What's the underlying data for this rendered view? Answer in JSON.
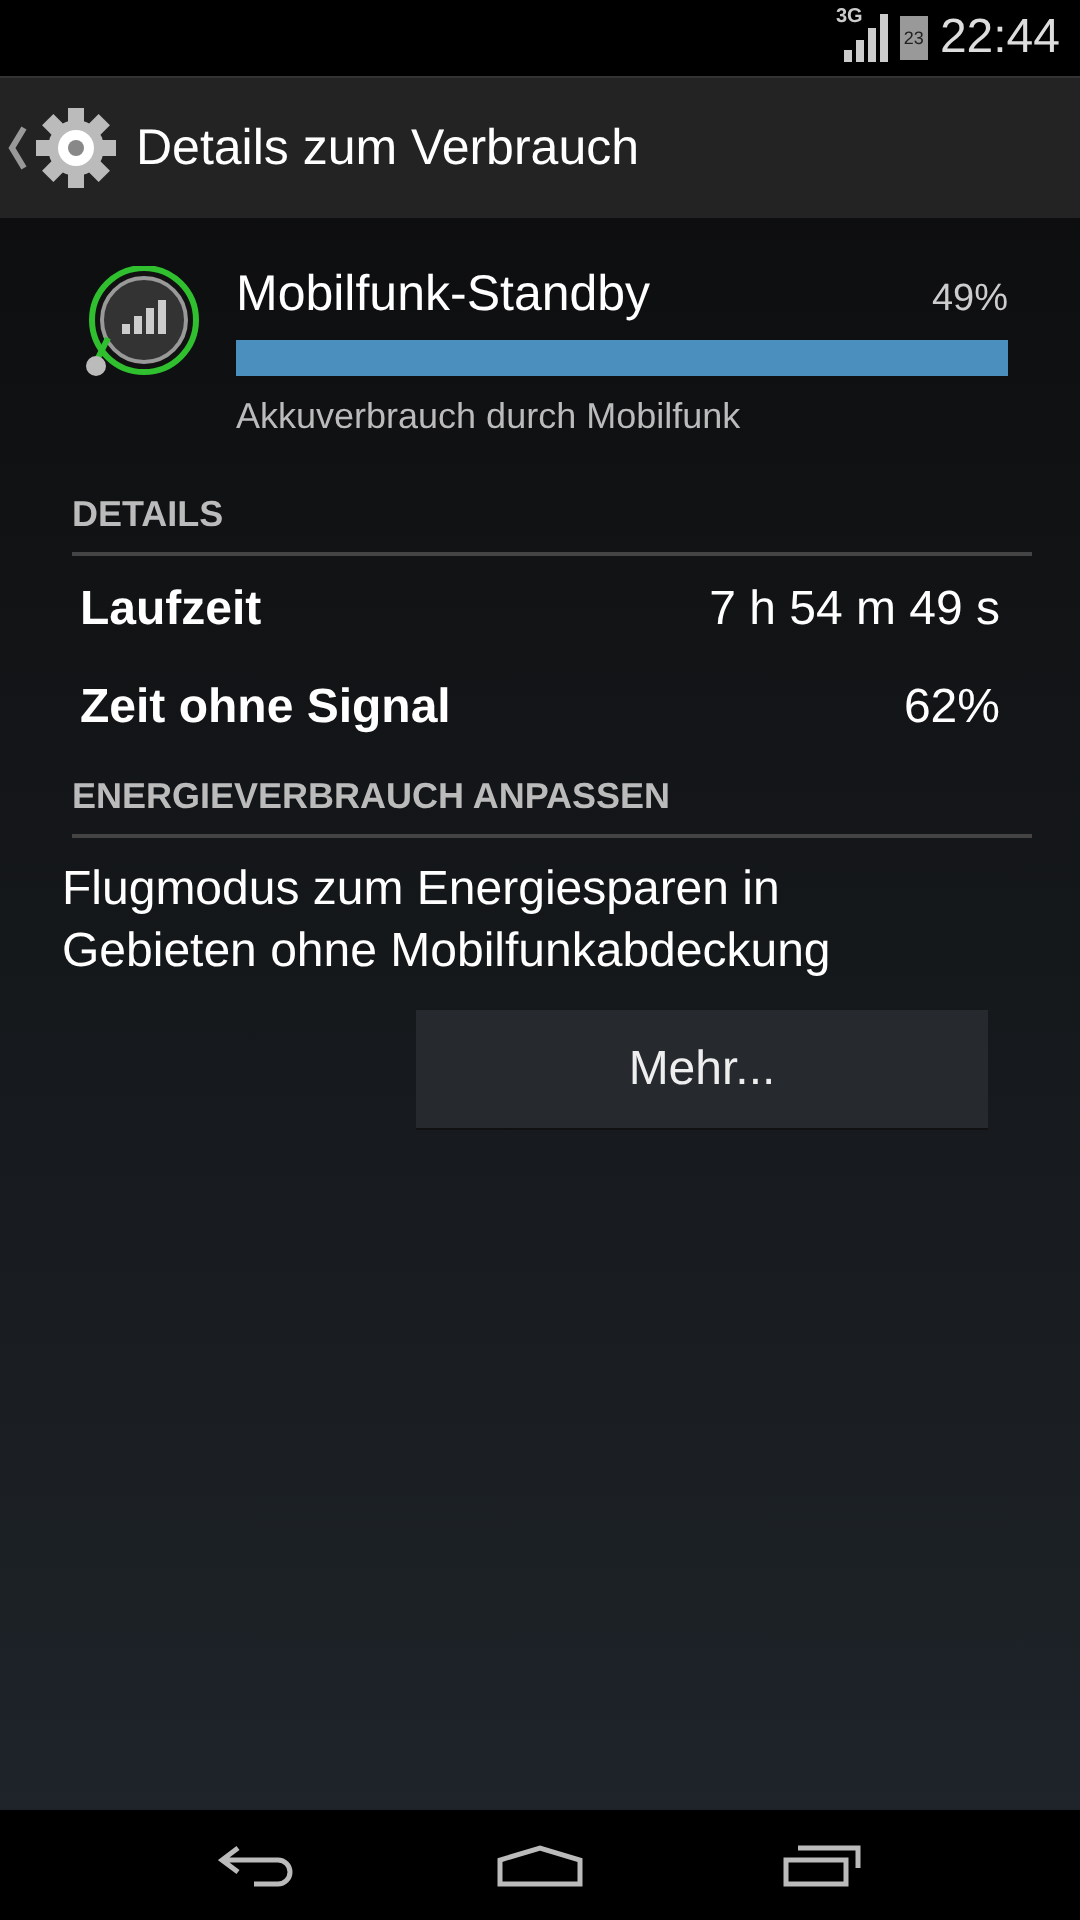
{
  "status_bar": {
    "network": "3G",
    "battery": "23",
    "time": "22:44"
  },
  "action_bar": {
    "title": "Details zum Verbrauch"
  },
  "usage": {
    "name": "Mobilfunk-Standby",
    "percent": "49%",
    "level": 1,
    "subtitle": "Akkuverbrauch durch Mobilfunk"
  },
  "details": {
    "header": "DETAILS",
    "rows": [
      {
        "label": "Laufzeit",
        "value": "7 h 54 m 49 s"
      },
      {
        "label": "Zeit ohne Signal",
        "value": "62%"
      }
    ]
  },
  "adjust": {
    "header": "ENERGIEVERBRAUCH ANPASSEN",
    "text": "Flugmodus zum Energiesparen in Gebieten ohne Mobilfunkabdeckung",
    "button": "Mehr..."
  }
}
